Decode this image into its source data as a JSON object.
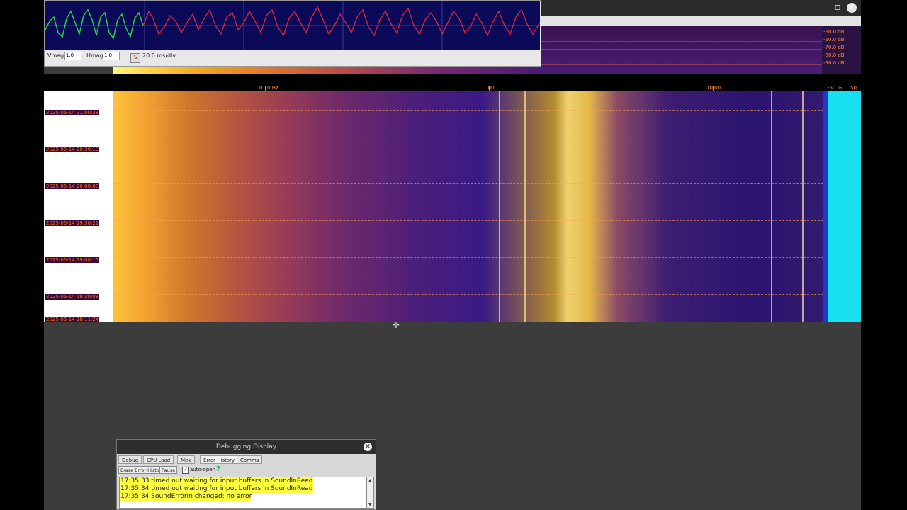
{
  "window": {
    "minimize_glyph": "◻",
    "close_glyph": "✕"
  },
  "scope": {
    "vmag_label": "Vmag",
    "vmag_value": "1.0",
    "hmag_label": "Hmag",
    "hmag_value": "1.0",
    "timebase": "20.0 ms/div",
    "trace_colors": {
      "left": "#27d645",
      "right": "#d8213a"
    }
  },
  "spectrum": {
    "db_labels": [
      "-50.0 dB",
      "-60.0 dB",
      "-70.0 dB",
      "-80.0 dB",
      "-90.0 dB"
    ]
  },
  "freq_axis": {
    "labels": [
      "0.10 Hz",
      "1.00",
      "10.00"
    ]
  },
  "pct_axis": {
    "labels": [
      "-50 %",
      "50"
    ]
  },
  "waterfall": {
    "timestamps": [
      "2025-06-14 21:00:28",
      "2025-06-14 20:30:13",
      "2025-06-14 20:00:00",
      "2025-06-14 19:30:22",
      "2025-06-14 19:00:15",
      "2025-06-14 18:30:08",
      "2025-06-14 18:11:24"
    ]
  },
  "debug": {
    "title": "Debugging Display",
    "tabs": [
      "Debug",
      "CPU Load",
      "Misc",
      "Error History",
      "Comms"
    ],
    "active_tab": "Error History",
    "erase_button": "Erase Error Histor",
    "pause_button": "Pause",
    "autoopen_label": "auto-open",
    "autoopen_check": "✓",
    "help_glyph": "?",
    "log": [
      "17:35:33 timed out waiting for input buffers in SoundInRead",
      "17:35:34 timed out waiting for input buffers in SoundInRead",
      "17:35:34 SoundErrorIn  changed: no error"
    ]
  }
}
